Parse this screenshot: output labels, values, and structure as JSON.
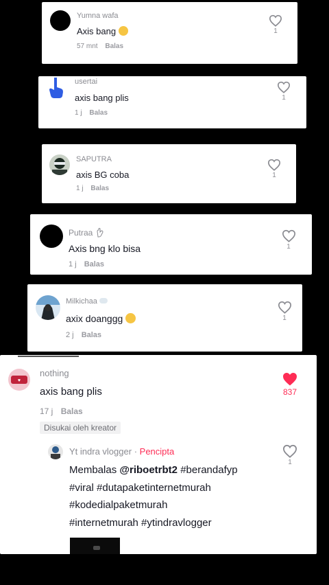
{
  "comments": [
    {
      "username": "Yumna wafa",
      "text": "Axis bang",
      "time": "57 mnt",
      "reply": "Balas",
      "likes": "1"
    },
    {
      "username": "usertai",
      "text": "axis bang plis",
      "time": "1 j",
      "reply": "Balas",
      "likes": "1"
    },
    {
      "username": "SAPUTRA",
      "text": "axis BG coba",
      "time": "1 j",
      "reply": "Balas",
      "likes": "1"
    },
    {
      "username": "Putraa",
      "text": "Axis bng klo bisa",
      "time": "1 j",
      "reply": "Balas",
      "likes": "1"
    },
    {
      "username": "Milkichaa",
      "text": "axix doanggg",
      "time": "2 j",
      "reply": "Balas",
      "likes": "1"
    },
    {
      "username": "nothing",
      "text": "axis bang plis",
      "time": "17 j",
      "reply": "Balas",
      "likes": "837",
      "liked_by_creator": "Disukai oleh kreator"
    }
  ],
  "creator_reply": {
    "username": "Yt indra vlogger",
    "separator": "·",
    "role": "Pencipta",
    "prefix": "Membalas",
    "mention": "@riboetrbt2",
    "tag1": "#berandafyp",
    "line2": "#viral #dutapaketinternetmurah",
    "line3": "#kodedialpaketmurah",
    "line4": "#internetmurah #ytindravlogger",
    "likes": "1"
  },
  "colors": {
    "accent": "#fe2c55",
    "muted": "#8a8b91",
    "text": "#161823",
    "background": "#000000"
  }
}
